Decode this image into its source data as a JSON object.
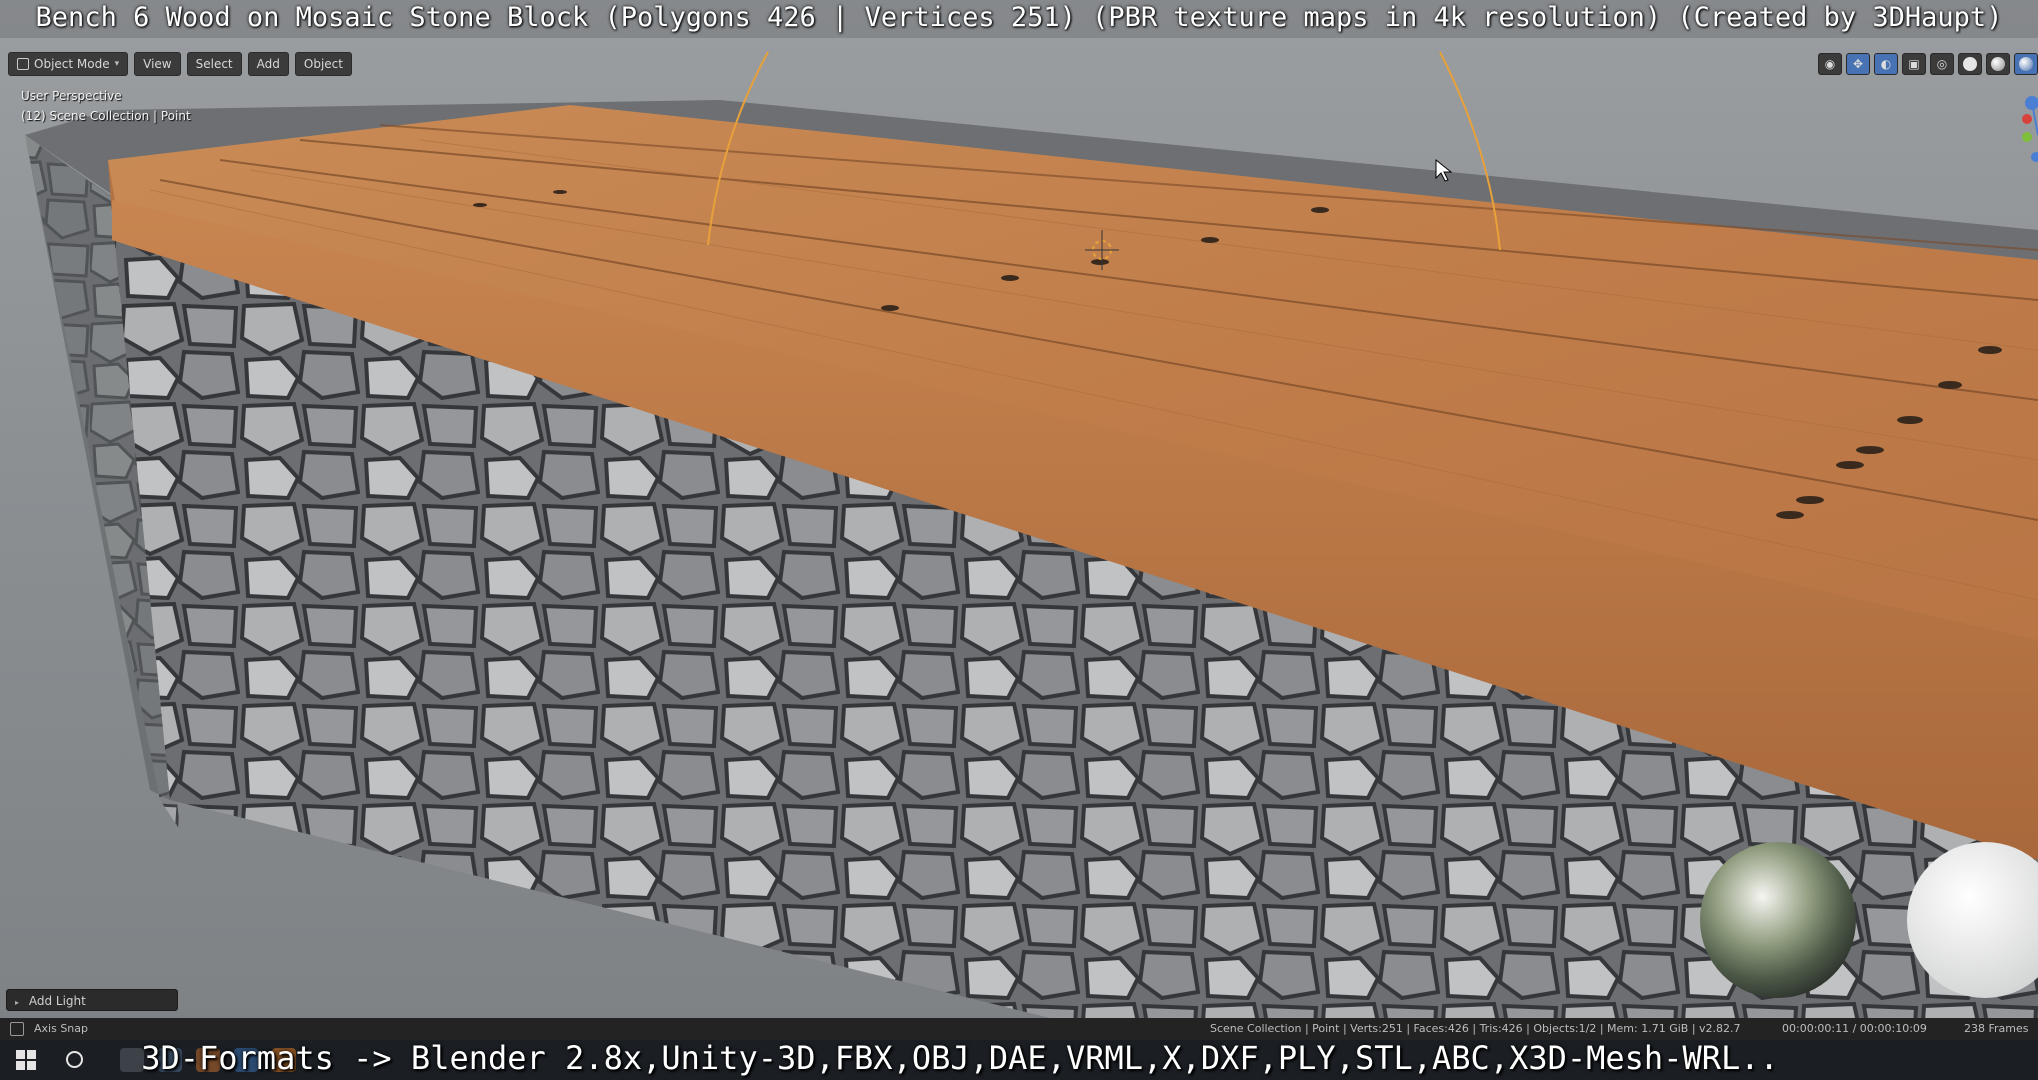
{
  "overlay_title": "Bench 6 Wood on Mosaic Stone Block (Polygons 426 | Vertices 251) (PBR texture maps in 4k resolution) (Created by 3DHaupt)",
  "header": {
    "mode_label": "Object Mode",
    "menus": [
      "View",
      "Select",
      "Add",
      "Object"
    ]
  },
  "viewport": {
    "perspective_label": "User Perspective",
    "collection_label": "(12) Scene Collection | Point"
  },
  "operator_panel": {
    "label": "Add Light"
  },
  "statusbar": {
    "left_label": "Axis Snap",
    "stats": "Scene Collection | Point | Verts:251 | Faces:426 | Tris:426 | Objects:1/2 | Mem: 1.71 GiB | v2.82.7",
    "time": "00:00:00:11 / 00:00:10:09",
    "frames": "238 Frames"
  },
  "caption": "3D-Formats -> Blender 2.8x,Unity-3D,FBX,OBJ,DAE,VRML,X,DXF,PLY,STL,ABC,X3D-Mesh-WRL..",
  "colors": {
    "wood": "#c4834f",
    "stone": "#8e9093",
    "light_line": "#e8a13a",
    "accent": "#4772b3"
  },
  "icons": {
    "header": [
      "object-mode-icon",
      "chevron-down-icon"
    ],
    "right_tools": [
      "visibility-icon",
      "gizmo-icon",
      "overlay-icon",
      "xray-icon",
      "wireframe-shading-icon",
      "solid-shading-icon",
      "material-shading-icon",
      "rendered-shading-icon"
    ],
    "taskbar": [
      "windows-start-icon",
      "search-icon"
    ]
  }
}
